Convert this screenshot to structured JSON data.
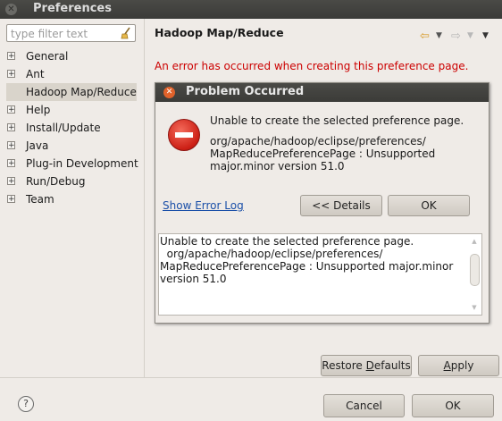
{
  "window": {
    "title": "Preferences"
  },
  "filter": {
    "placeholder": "type filter text"
  },
  "tree": {
    "items": [
      {
        "label": "General",
        "expandable": true,
        "selected": false
      },
      {
        "label": "Ant",
        "expandable": true,
        "selected": false
      },
      {
        "label": "Hadoop Map/Reduce",
        "expandable": false,
        "selected": true
      },
      {
        "label": "Help",
        "expandable": true,
        "selected": false
      },
      {
        "label": "Install/Update",
        "expandable": true,
        "selected": false
      },
      {
        "label": "Java",
        "expandable": true,
        "selected": false
      },
      {
        "label": "Plug-in Development",
        "expandable": true,
        "selected": false
      },
      {
        "label": "Run/Debug",
        "expandable": true,
        "selected": false
      },
      {
        "label": "Team",
        "expandable": true,
        "selected": false
      }
    ]
  },
  "page": {
    "title": "Hadoop Map/Reduce",
    "error": "An error has occurred when creating this preference page."
  },
  "dialog": {
    "title": "Problem Occurred",
    "message": "Unable to create the selected preference page.",
    "detail": "org/apache/hadoop/eclipse/preferences/\nMapReducePreferencePage : Unsupported\nmajor.minor version 51.0",
    "show_log": "Show Error Log",
    "details_button": "<< Details",
    "ok_button": "OK",
    "details_text": "Unable to create the selected preference page.\n  org/apache/hadoop/eclipse/preferences/\nMapReducePreferencePage : Unsupported major.minor\nversion 51.0"
  },
  "buttons": {
    "restore_defaults": "Restore Defaults",
    "apply": "Apply",
    "cancel": "Cancel",
    "ok": "OK"
  },
  "colors": {
    "error": "#cc0000",
    "link": "#1a4fa8",
    "stop_icon": "#cc1f15"
  }
}
